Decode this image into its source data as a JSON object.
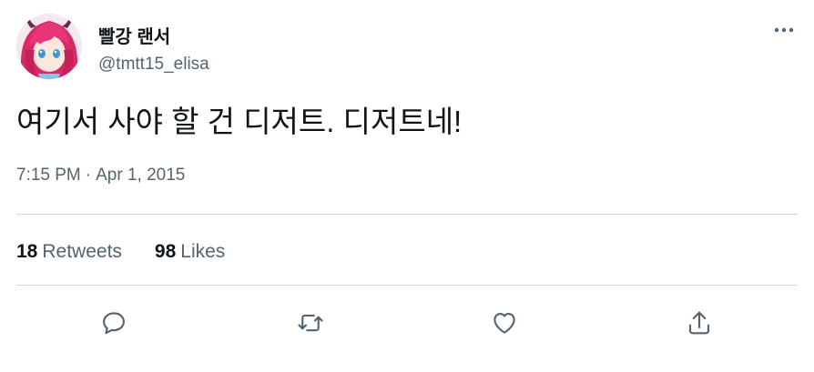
{
  "tweet": {
    "author": {
      "display_name": "빨강 랜서",
      "handle": "@tmtt15_elisa"
    },
    "text": "여기서 사야 할 건 디저트. 디저트네!",
    "time": "7:15 PM",
    "separator": "·",
    "date": "Apr 1, 2015",
    "stats": {
      "retweets_count": "18",
      "retweets_label": "Retweets",
      "likes_count": "98",
      "likes_label": "Likes"
    }
  },
  "icons": {
    "more": "more-dots-icon",
    "reply": "reply-icon",
    "retweet": "retweet-icon",
    "like": "heart-icon",
    "share": "share-icon"
  },
  "colors": {
    "text_primary": "#0f1419",
    "text_secondary": "#536471",
    "divider": "#cfd9de",
    "icon": "#536471",
    "avatar_hair": "#e0306e"
  }
}
